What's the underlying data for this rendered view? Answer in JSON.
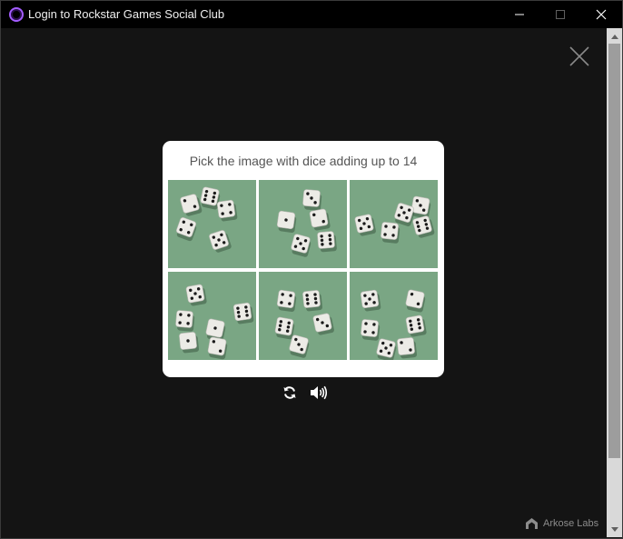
{
  "window": {
    "title": "Login to Rockstar Games Social Club",
    "icon": "rockstar-social-club-icon",
    "controls": [
      "minimize-icon",
      "maximize-icon",
      "close-icon"
    ]
  },
  "challenge": {
    "prompt": "Pick the image with dice adding up to 14",
    "tiles": [
      {
        "id": "tile-1",
        "dice": [
          2,
          6,
          4,
          4,
          5
        ]
      },
      {
        "id": "tile-2",
        "dice": [
          3,
          2,
          5,
          6,
          1
        ]
      },
      {
        "id": "tile-3",
        "dice": [
          3,
          5,
          4,
          6,
          5
        ]
      },
      {
        "id": "tile-4",
        "dice": [
          5,
          4,
          6,
          1,
          1,
          2
        ]
      },
      {
        "id": "tile-5",
        "dice": [
          4,
          6,
          6,
          3,
          3
        ]
      },
      {
        "id": "tile-6",
        "dice": [
          5,
          2,
          4,
          6,
          5,
          2
        ]
      }
    ],
    "controls": {
      "refresh": "refresh-icon",
      "audio": "audio-icon"
    }
  },
  "footer": {
    "brand": "Arkose Labs",
    "brand_icon": "arkose-logo-icon"
  },
  "colors": {
    "titlebar": "#000000",
    "background": "#141414",
    "modal": "#ffffff",
    "felt": "#6f9d7a",
    "accent_icon": "#a35cff"
  }
}
